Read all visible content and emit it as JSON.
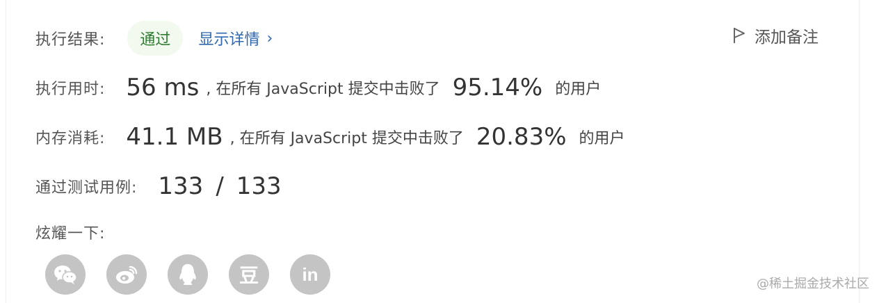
{
  "result": {
    "label": "执行结果:",
    "status": "通过",
    "details_link": "显示详情",
    "details_chevron": "›",
    "add_note": "添加备注"
  },
  "runtime": {
    "label": "执行用时:",
    "value": "56 ms",
    "text_before": ", 在所有 JavaScript 提交中击败了",
    "percent": "95.14%",
    "text_after": "的用户"
  },
  "memory": {
    "label": "内存消耗:",
    "value": "41.1 MB",
    "text_before": ", 在所有 JavaScript 提交中击败了",
    "percent": "20.83%",
    "text_after": "的用户"
  },
  "testcases": {
    "label": "通过测试用例:",
    "passed": "133",
    "separator": "/",
    "total": "133"
  },
  "share": {
    "label": "炫耀一下:",
    "icons": [
      "wechat-icon",
      "weibo-icon",
      "qq-icon",
      "douban-icon",
      "linkedin-icon"
    ],
    "douban_glyph": "豆",
    "linkedin_glyph": "in"
  },
  "watermark": "@稀土掘金技术社区",
  "colors": {
    "accent_link": "#2f67b0",
    "status_green": "#2e7d32",
    "status_bg": "#f2f9ef",
    "icon_gray": "#c4c4c4"
  }
}
